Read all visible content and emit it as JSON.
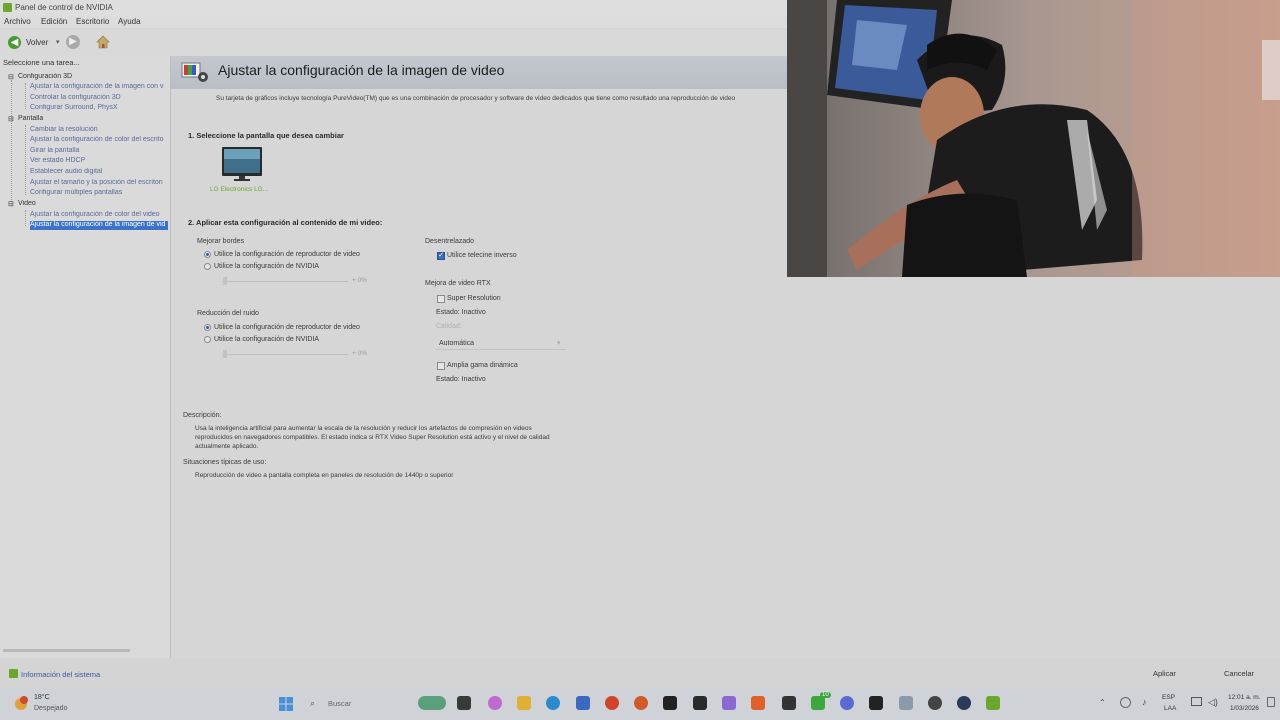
{
  "window": {
    "title": "Panel de control de NVIDIA",
    "menus": [
      "Archivo",
      "Edición",
      "Escritorio",
      "Ayuda"
    ],
    "back_label": "Volver"
  },
  "sidebar": {
    "header": "Seleccione una tarea...",
    "categories": [
      {
        "label": "Configuración 3D",
        "items": [
          "Ajustar la configuración de la imagen con v",
          "Controlar la configuración 3D",
          "Configurar Surround, PhysX"
        ]
      },
      {
        "label": "Pantalla",
        "items": [
          "Cambiar la resolución",
          "Ajustar la configuración de color del escrito",
          "Girar la pantalla",
          "Ver estado HDCP",
          "Establecer audio digital",
          "Ajustar el tamaño y la posición del escritori",
          "Configurar múltiples pantallas"
        ]
      },
      {
        "label": "Video",
        "items": [
          "Ajustar la configuración de color del video",
          "Ajustar la configuración de la imagen de vid"
        ]
      }
    ]
  },
  "main": {
    "title": "Ajustar la configuración de la imagen de video",
    "intro": "Su tarjeta de gráficos incluye tecnología PureVideo(TM) que es una combinación de procesador y software de video dedicados que tiene como resultado una reproducción de video",
    "step1": "1. Seleccione la pantalla que desea cambiar",
    "monitor_label": "LG Electronics LG...",
    "step2": "2. Aplicar esta configuración al contenido de mi video:",
    "edge": {
      "title": "Mejorar bordes",
      "opt1": "Utilice la configuración de reproductor de video",
      "opt2": "Utilice la configuración de NVIDIA",
      "value": "+ 0%"
    },
    "noise": {
      "title": "Reducción del ruido",
      "opt1": "Utilice la configuración de reproductor de video",
      "opt2": "Utilice la configuración de NVIDIA",
      "value": "+ 0%"
    },
    "deinterlace": {
      "title": "Desentrelazado",
      "option": "Utilice telecine inverso"
    },
    "rtx": {
      "title": "Mejora de video RTX",
      "super_res": "Super Resolution",
      "state1": "Estado: Inactivo",
      "quality_label": "Calidad:",
      "dropdown": "Automática",
      "hdr": "Amplia gama dinámica",
      "state2": "Estado: Inactivo"
    },
    "description_label": "Descripción:",
    "description": "Usa la inteligencia artificial para aumentar la escala de la resolución y reducir los artefactos de compresión en videos reproducidos en navegadores compatibles.  El estado indica si RTX Video Super Resolution está activo y el nivel de calidad actualmente aplicado.",
    "usage_label": "Situaciones típicas de uso:",
    "usage": "Reproducción de video a pantalla completa en paneles de resolución de 1440p o superior"
  },
  "footer": {
    "system_info": "Información del sistema",
    "apply": "Aplicar",
    "cancel": "Cancelar"
  },
  "taskbar": {
    "weather_temp": "18°C",
    "weather_desc": "Despejado",
    "search_placeholder": "Buscar",
    "lang1": "ESP",
    "lang2": "LAA",
    "time": "12:01 a. m.",
    "date": "1/03/2026",
    "discord_badge": "10"
  }
}
